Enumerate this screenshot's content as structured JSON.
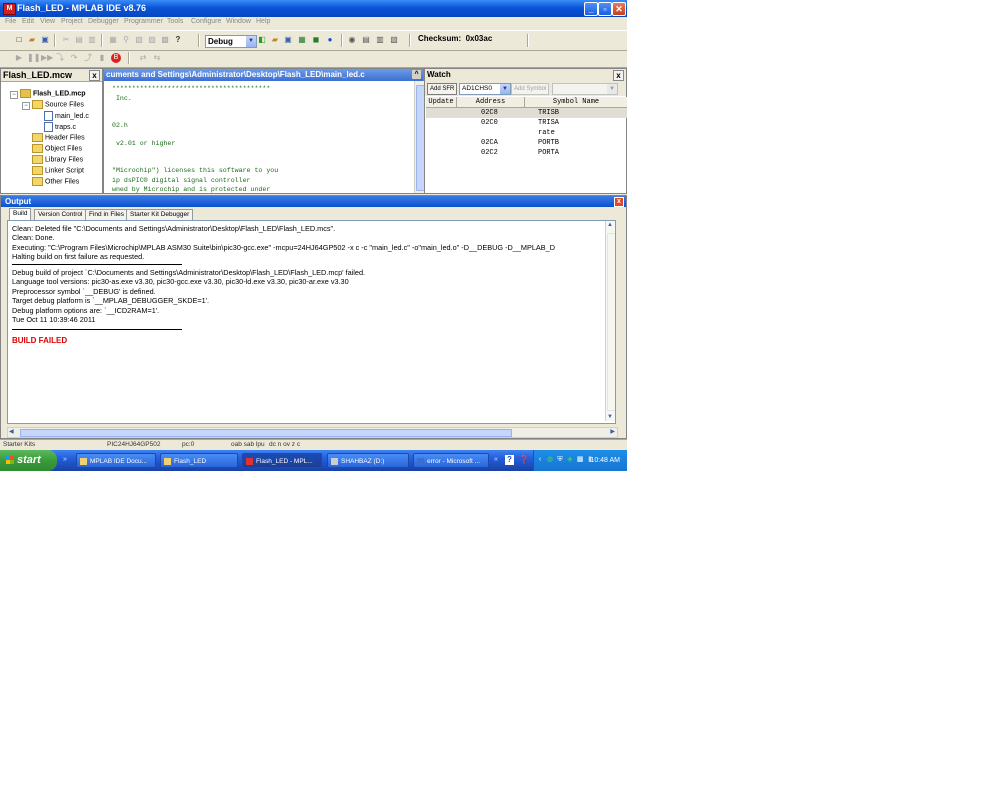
{
  "window": {
    "title": "Flash_LED - MPLAB IDE v8.76",
    "minimize": "_",
    "restore": "▫",
    "close": "✕"
  },
  "menu": [
    "File",
    "Edit",
    "View",
    "Project",
    "Debugger",
    "Programmer",
    "Tools",
    "Configure",
    "Window",
    "Help"
  ],
  "toolbar": {
    "build_config": "Debug",
    "checksum_label": "Checksum:",
    "checksum_value": "0x03ac"
  },
  "workspace": {
    "title": "Flash_LED.mcw",
    "close": "x",
    "project": "Flash_LED.mcp",
    "source_files": "Source Files",
    "files": [
      "main_led.c",
      "traps.c"
    ],
    "folders": [
      "Header Files",
      "Object Files",
      "Library Files",
      "Linker Script",
      "Other Files"
    ]
  },
  "editor": {
    "path": "cuments and Settings\\Administrator\\Desktop\\Flash_LED\\main_led.c",
    "lines": [
      "****************************************",
      " Inc.",
      "",
      "",
      "",
      "02.h",
      "",
      "",
      "",
      " v2.01 or higher",
      "",
      "",
      "",
      "\"Microchip\") licenses this software to you",
      "ip dsPIC® digital signal controller",
      "wned by Microchip and is protected under"
    ]
  },
  "watch": {
    "title": "Watch",
    "close": "x",
    "add_sfr": "Add SFR",
    "sfr_select": "AD1CHS0",
    "add_symbol": "Add Symbol",
    "columns": [
      "Update",
      "Address",
      "Symbol Name"
    ],
    "rows": [
      {
        "address": "02C8",
        "symbol": "TRISB"
      },
      {
        "address": "02C0",
        "symbol": "TRISA"
      },
      {
        "address": "",
        "symbol": "rate"
      },
      {
        "address": "02CA",
        "symbol": "PORTB"
      },
      {
        "address": "02C2",
        "symbol": "PORTA"
      }
    ]
  },
  "output": {
    "title": "Output",
    "close": "x",
    "tabs": [
      "Build",
      "Version Control",
      "Find in Files",
      "Starter Kit Debugger"
    ],
    "lines": [
      "Clean: Deleted file \"C:\\Documents and Settings\\Administrator\\Desktop\\Flash_LED\\Flash_LED.mcs\".",
      "Clean: Done.",
      "Executing: \"C:\\Program Files\\Microchip\\MPLAB ASM30 Suite\\bin\\pic30-gcc.exe\" -mcpu=24HJ64GP502 -x c -c   \"main_led.c\" -o\"main_led.o\" -D__DEBUG -D__MPLAB_D",
      "Halting build on first failure as requested.",
      "Debug build of project `C:\\Documents and Settings\\Administrator\\Desktop\\Flash_LED\\Flash_LED.mcp' failed.",
      "Language tool versions: pic30-as.exe v3.30, pic30-gcc.exe v3.30, pic30-ld.exe v3.30, pic30-ar.exe v3.30",
      "Preprocessor symbol `__DEBUG' is defined.",
      "Target debug platform is `__MPLAB_DEBUGGER_SKDE=1'.",
      "Debug platform options are: `__ICD2RAM=1'.",
      "Tue Oct 11 10:39:46 2011"
    ],
    "result": "BUILD FAILED"
  },
  "statusbar": [
    "Starter Kits",
    "PIC24HJ64GP502",
    "pc:0",
    "oab sab lpu",
    "dc n ov z c"
  ],
  "taskbar": {
    "start": "start",
    "tasks": [
      "MPLAB IDE Docu...",
      "Flash_LED",
      "Flash_LED - MPL...",
      "SHAHBAZ (D:)",
      "error - Microsoft ..."
    ],
    "clock": "10:48 AM"
  },
  "colors": {
    "titlebar": "#0a55d8",
    "build_failed": "#e00000",
    "code_comment": "#1a6b1a",
    "taskbar": "#245edb"
  }
}
